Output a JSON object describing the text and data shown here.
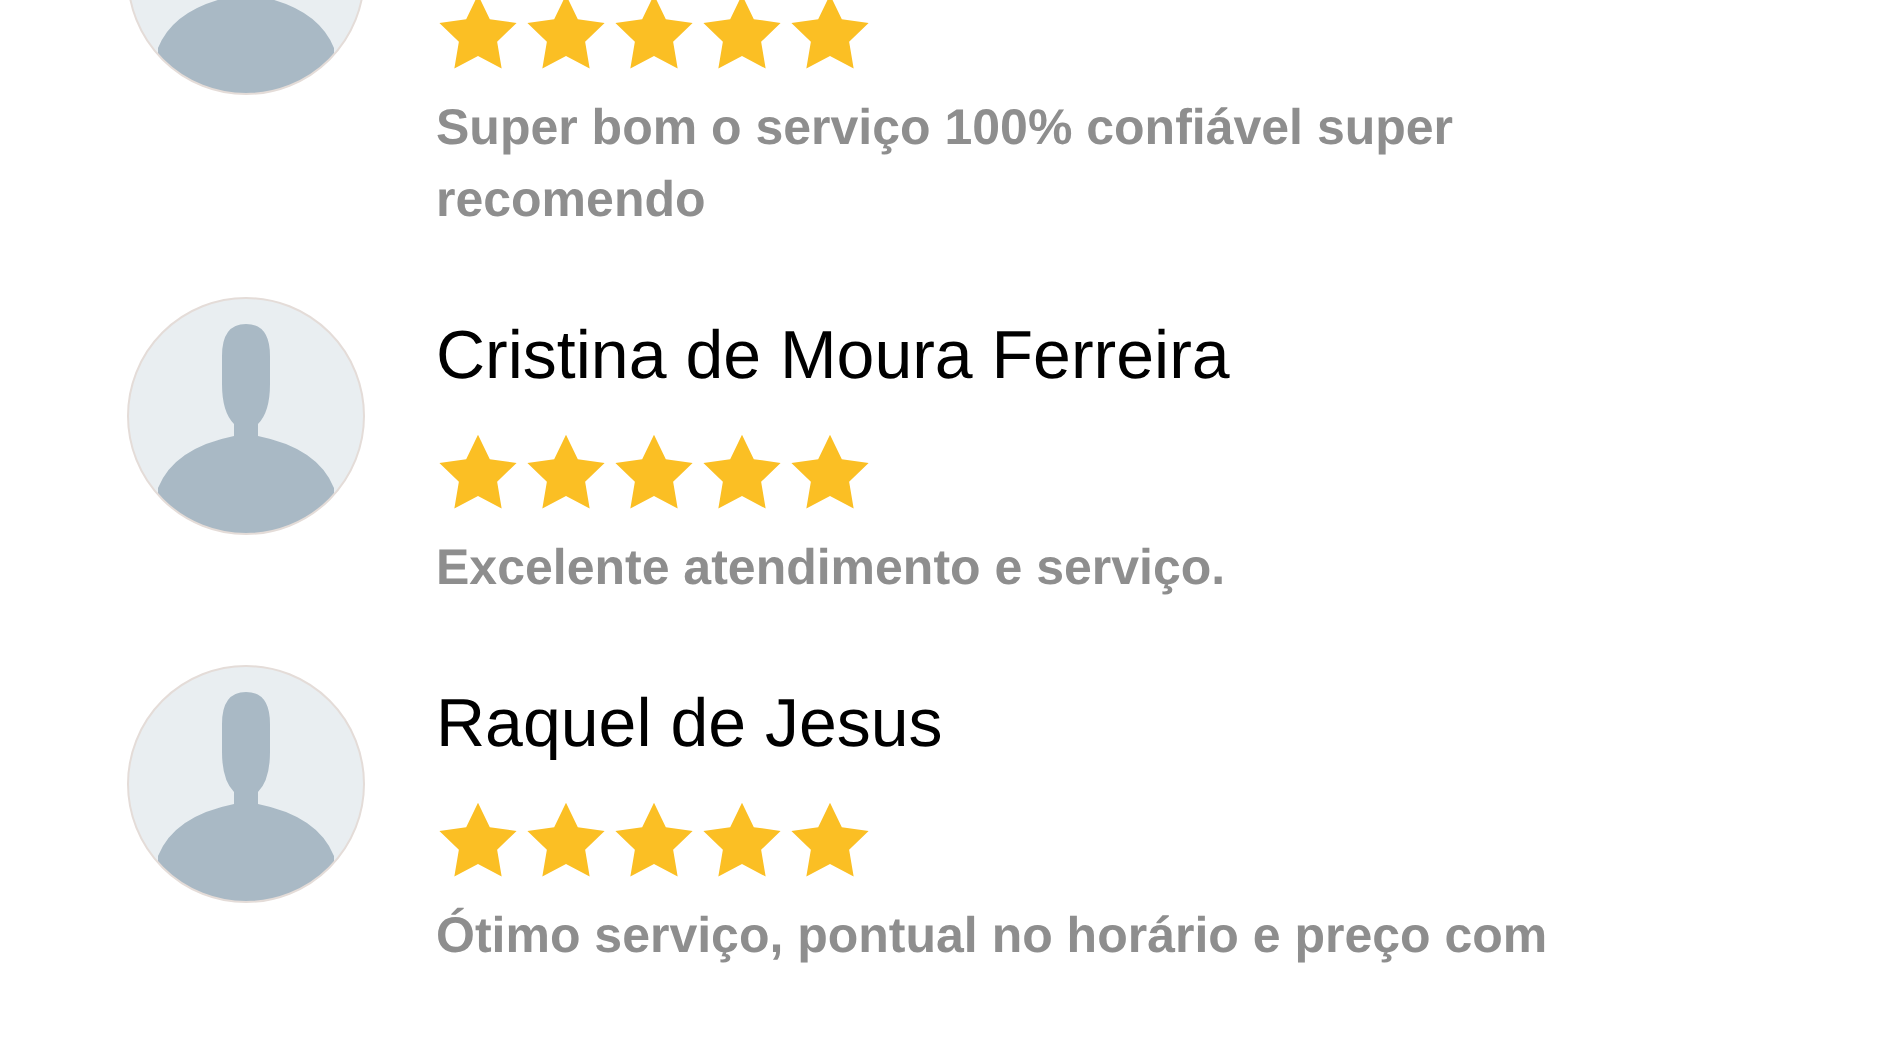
{
  "reviews": [
    {
      "stars": 5,
      "text": "Super bom o serviço 100% confiável super recomendo"
    },
    {
      "name": "Cristina de Moura Ferreira",
      "stars": 5,
      "text": "Excelente atendimento e serviço."
    },
    {
      "name": "Raquel de Jesus",
      "stars": 5,
      "text": "Ótimo serviço, pontual no horário e preço com"
    }
  ]
}
